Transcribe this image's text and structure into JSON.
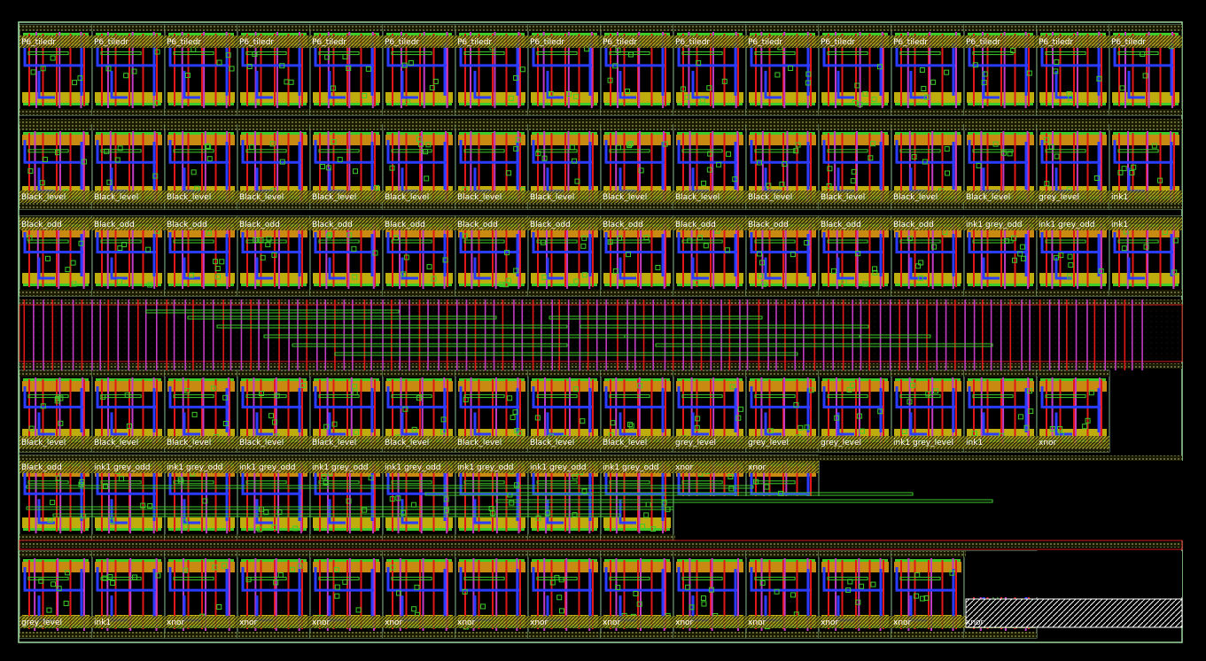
{
  "app": {
    "view": "layout-editor-canvas"
  },
  "colors": {
    "background": "#000000",
    "boundary": "#9fd89f",
    "boundary_red": "#d42020",
    "metal1_blue": "#2a3cff",
    "poly_red": "#e01818",
    "metal2_magenta": "#c23bc2",
    "diffusion_green": "#3dcc2a",
    "well_orange": "#c88a10",
    "well_yellow": "#d4c010",
    "label_white": "#ffffff"
  },
  "cell_rows": [
    {
      "id": "row1",
      "labels": [
        "P6_tiledr",
        "P6_tiledr",
        "P6_tiledr",
        "P6_tiledr",
        "P6_tiledr",
        "P6_tiledr",
        "P6_tiledr",
        "P6_tiledr",
        "P6_tiledr",
        "P6_tiledr",
        "P6_tiledr",
        "P6_tiledr",
        "P6_tiledr",
        "P6_tiledr",
        "P6_tiledr",
        "P6_tiledr"
      ]
    },
    {
      "id": "row2",
      "labels": [
        "Black_level",
        "Black_level",
        "Black_level",
        "Black_level",
        "Black_level",
        "Black_level",
        "Black_level",
        "Black_level",
        "Black_level",
        "Black_level",
        "Black_level",
        "Black_level",
        "Black_level",
        "Black_level",
        "grey_level",
        "ink1"
      ]
    },
    {
      "id": "row3",
      "labels": [
        "Black_odd",
        "Black_odd",
        "Black_odd",
        "Black_odd",
        "Black_odd",
        "Black_odd",
        "Black_odd",
        "Black_odd",
        "Black_odd",
        "Black_odd",
        "Black_odd",
        "Black_odd",
        "Black_odd",
        "ink1 grey_odd",
        "ink1 grey_odd",
        "ink1"
      ]
    },
    {
      "id": "row4",
      "labels": [
        "Black_level",
        "Black_level",
        "Black_level",
        "Black_level",
        "Black_level",
        "Black_level",
        "Black_level",
        "Black_level",
        "Black_level",
        "grey_level",
        "grey_level",
        "grey_level",
        "ink1 grey_level",
        "ink1",
        "xnor"
      ]
    },
    {
      "id": "row5",
      "labels": [
        "Black_odd",
        "ink1 grey_odd",
        "ink1 grey_odd",
        "ink1 grey_odd",
        "ink1 grey_odd",
        "ink1 grey_odd",
        "ink1 grey_odd",
        "ink1 grey_odd",
        "ink1 grey_odd",
        "xnor",
        "xnor"
      ]
    },
    {
      "id": "row6",
      "labels": [
        "grey_level",
        "ink1",
        "xnor",
        "xnor",
        "xnor",
        "xnor",
        "xnor",
        "xnor",
        "xnor",
        "xnor",
        "xnor",
        "xnor",
        "xnor",
        "xnor"
      ]
    }
  ]
}
